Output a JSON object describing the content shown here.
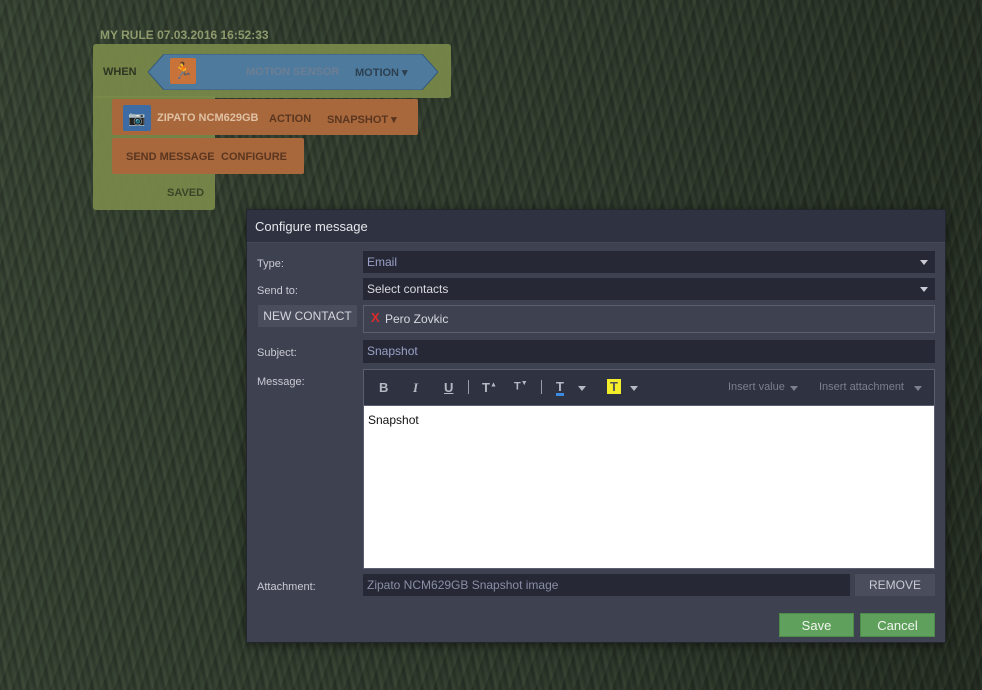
{
  "rule": {
    "title": "MY RULE 07.03.2016 16:52:33",
    "when_label": "WHEN",
    "sensor_label": "MOTION SENSOR",
    "sensor_value": "MOTION ▾",
    "camera_label": "ZIPATO NCM629GB",
    "camera_action": "ACTION",
    "camera_value": "SNAPSHOT ▾",
    "message_label": "SEND MESSAGE",
    "message_configure": "CONFIGURE",
    "saved_label": "SAVED"
  },
  "dialog": {
    "title": "Configure message",
    "type_label": "Type:",
    "type_value": "Email",
    "sendto_label": "Send to:",
    "sendto_value": "Select contacts",
    "new_contact_label": "NEW CONTACT",
    "contact_name": "Pero Zovkic",
    "remove_contact_glyph": "X",
    "subject_label": "Subject:",
    "subject_value": "Snapshot",
    "message_label": "Message:",
    "toolbar": {
      "bold": "B",
      "italic": "I",
      "underline": "U",
      "font_grow": "T",
      "font_shrink": "T",
      "text_color": "T",
      "highlight": "T",
      "insert_value": "Insert value",
      "insert_attachment": "Insert attachment"
    },
    "message_body": "Snapshot",
    "attachment_label": "Attachment:",
    "attachment_value": "Zipato NCM629GB Snapshot image",
    "remove_label": "REMOVE",
    "save_label": "Save",
    "cancel_label": "Cancel"
  },
  "colors": {
    "accent_green": "#5fa15c",
    "block_orange": "#a9683c",
    "block_olive": "#7a8a4a",
    "block_blue": "#4e7a9e"
  },
  "icons": [
    "motion-sensor-icon",
    "camera-icon",
    "dropdown-caret-icon",
    "remove-contact-icon"
  ]
}
